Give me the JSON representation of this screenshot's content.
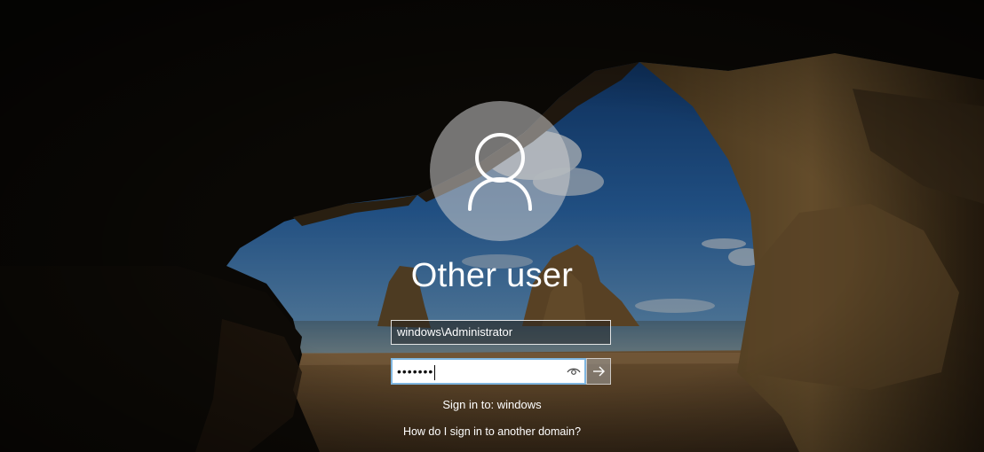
{
  "login": {
    "username": "Other user",
    "username_field_value": "windows\\Administrator",
    "password_masked": "•••••••",
    "sign_in_to": "Sign in to: windows",
    "another_domain_link": "How do I sign in to another domain?"
  },
  "icons": {
    "avatar": "user-silhouette-icon",
    "reveal": "eye-icon",
    "submit": "arrow-right-icon"
  },
  "colors": {
    "focus_border": "#7fb6e0",
    "text": "#ffffff"
  }
}
